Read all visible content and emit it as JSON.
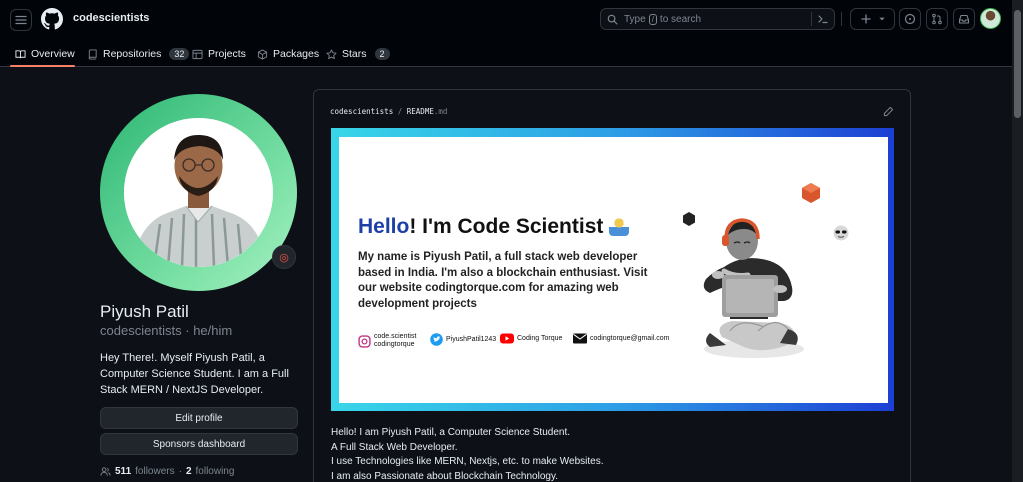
{
  "header": {
    "org_name": "codescientists",
    "search_placeholder_pre": "Type",
    "search_slash": "/",
    "search_placeholder_post": "to search",
    "icons": [
      "hamburger-icon",
      "github-logo-icon",
      "search-icon",
      "terminal-icon",
      "plus-icon",
      "issue-icon",
      "pull-request-icon",
      "inbox-icon"
    ]
  },
  "tabs": [
    {
      "label": "Overview",
      "icon": "book-icon"
    },
    {
      "label": "Repositories",
      "icon": "repo-icon",
      "count": "32"
    },
    {
      "label": "Projects",
      "icon": "table-icon"
    },
    {
      "label": "Packages",
      "icon": "package-icon"
    },
    {
      "label": "Stars",
      "icon": "star-icon",
      "count": "2"
    }
  ],
  "profile": {
    "full_name": "Piyush Patil",
    "login_line": "codescientists · he/him",
    "bio": "Hey There!. Myself Piyush Patil, a Computer Science Student. I am a Full Stack MERN / NextJS Developer.",
    "edit_profile": "Edit profile",
    "sponsors_dashboard": "Sponsors dashboard",
    "followers_count": "511",
    "followers_label": "followers",
    "following_count": "2",
    "following_label": "following"
  },
  "readme": {
    "repo": "codescientists",
    "file": "README",
    "ext": ".md",
    "banner": {
      "hello_blue": "Hello",
      "hello_rest": "! I'm Code Scientist",
      "desc": "My name is Piyush Patil, a full stack web developer based in India. I'm also a blockchain enthusiast. Visit our website codingtorque.com for amazing web development projects",
      "instagram_1": "code.scientist",
      "instagram_2": "codingtorque",
      "twitter": "PiyushPatil1243",
      "youtube": "Coding Torque",
      "email": "codingtorque@gmail.com"
    },
    "lines": [
      "Hello! I am Piyush Patil, a Computer Science Student.",
      "A Full Stack Web Developer.",
      "I use Technologies like MERN, Nextjs, etc. to make Websites.",
      "I am also Passionate about Blockchain Technology."
    ]
  },
  "colors": {
    "accent_underline": "#f78166",
    "banner_blue": "#1d3fa8",
    "avatar_ring": "#2bb673"
  }
}
